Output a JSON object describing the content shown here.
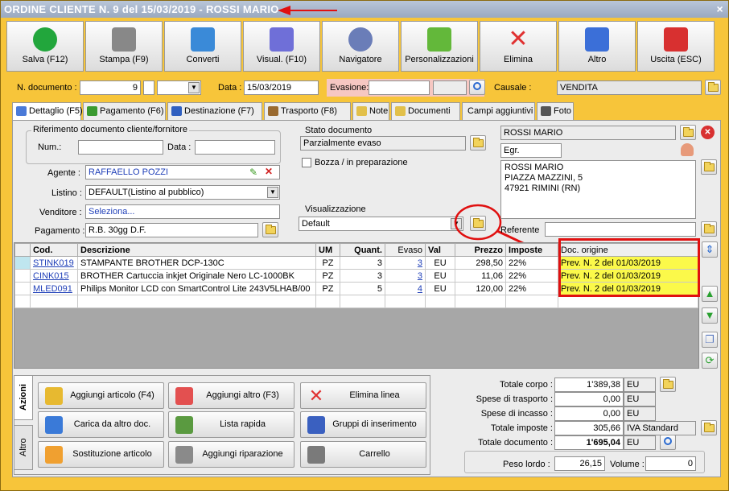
{
  "window": {
    "title": "ORDINE CLIENTE N. 9 del 15/03/2019 - ROSSI MARIO",
    "close": "×"
  },
  "toolbar": [
    {
      "label": "Salva (F12)",
      "icon": "check-icon"
    },
    {
      "label": "Stampa (F9)",
      "icon": "printer-icon"
    },
    {
      "label": "Converti",
      "icon": "convert-icon"
    },
    {
      "label": "Visual. (F10)",
      "icon": "magic-wand-icon"
    },
    {
      "label": "Navigatore",
      "icon": "compass-icon"
    },
    {
      "label": "Personalizzazioni",
      "icon": "puzzle-icon"
    },
    {
      "label": "Elimina",
      "icon": "delete-x-icon"
    },
    {
      "label": "Altro",
      "icon": "magnifier-icon"
    },
    {
      "label": "Uscita (ESC)",
      "icon": "power-icon"
    }
  ],
  "header": {
    "ndoc_label": "N. documento :",
    "ndoc_value": "9",
    "data_label": "Data :",
    "data_value": "15/03/2019",
    "evasione_label": "Evasione:",
    "causale_label": "Causale :",
    "causale_value": "VENDITA"
  },
  "tabs": [
    "Dettaglio (F5)",
    "Pagamento (F6)",
    "Destinazione (F7)",
    "Trasporto (F8)",
    "Note",
    "Documenti",
    "Campi aggiuntivi",
    "Foto"
  ],
  "rif": {
    "title": "Riferimento documento cliente/fornitore",
    "num_label": "Num.:",
    "data_label": "Data :"
  },
  "agente": {
    "label": "Agente :",
    "value": "RAFFAELLO POZZI"
  },
  "listino": {
    "label": "Listino :",
    "value": "DEFAULT(Listino al pubblico)"
  },
  "venditore": {
    "label": "Venditore :",
    "value": "Seleziona..."
  },
  "pagamento": {
    "label": "Pagamento :",
    "value": "R.B. 30gg D.F."
  },
  "stato": {
    "title": "Stato documento",
    "value": "Parzialmente evaso",
    "bozza": "Bozza / in preparazione"
  },
  "visual": {
    "title": "Visualizzazione",
    "value": "Default"
  },
  "cliente": {
    "name": "ROSSI MARIO",
    "title": "Egr.",
    "address": [
      "ROSSI MARIO",
      "PIAZZA MAZZINI, 5",
      "47921 RIMINI (RN)"
    ],
    "referente_label": "Referente"
  },
  "grid": {
    "headers": [
      "Cod.",
      "Descrizione",
      "UM",
      "Quant.",
      "Evaso",
      "Val",
      "Prezzo",
      "Imposte",
      "Doc. origine"
    ],
    "rows": [
      [
        "STINK019",
        "STAMPANTE BROTHER DCP-130C",
        "PZ",
        "3",
        "3",
        "EU",
        "298,50",
        "22%",
        "Prev. N. 2 del 01/03/2019"
      ],
      [
        "CINK015",
        "BROTHER Cartuccia inkjet Originale Nero LC-1000BK",
        "PZ",
        "3",
        "3",
        "EU",
        "11,06",
        "22%",
        "Prev. N. 2 del 01/03/2019"
      ],
      [
        "MLED091",
        "Philips Monitor LCD con SmartControl Lite 243V5LHAB/00",
        "PZ",
        "5",
        "4",
        "EU",
        "120,00",
        "22%",
        "Prev. N. 2 del 01/03/2019"
      ]
    ]
  },
  "side_tabs": [
    "Azioni",
    "Altro"
  ],
  "actions": [
    "Aggiungi articolo (F4)",
    "Aggiungi altro (F3)",
    "Elimina linea",
    "Carica da altro doc.",
    "Lista rapida",
    "Gruppi di inserimento",
    "Sostituzione articolo",
    "Aggiungi riparazione",
    "Carrello"
  ],
  "totals": [
    {
      "label": "Totale corpo :",
      "value": "1'389,38",
      "unit": "EU"
    },
    {
      "label": "Spese di trasporto :",
      "value": "0,00",
      "unit": "EU"
    },
    {
      "label": "Spese di incasso :",
      "value": "0,00",
      "unit": "EU"
    },
    {
      "label": "Totale imposte :",
      "value": "305,66",
      "unit": "IVA Standard"
    },
    {
      "label": "Totale documento :",
      "value": "1'695,04",
      "unit": "EU"
    }
  ],
  "peso": {
    "label": "Peso lordo :",
    "value": "26,15",
    "volume_label": "Volume :",
    "volume_value": "0"
  }
}
